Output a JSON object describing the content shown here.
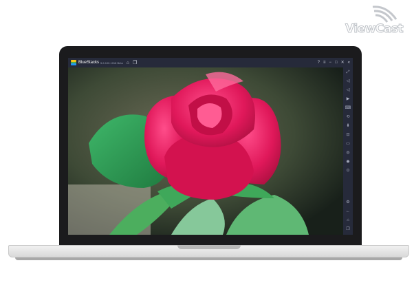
{
  "watermark": {
    "text": "ViewCast",
    "icon": "signal-waves-icon"
  },
  "window": {
    "app_name": "BlueStacks",
    "version": "5.6.100.1018 Beta",
    "title_icons": [
      "home-icon",
      "multi-instance-icon"
    ],
    "controls": [
      "help-icon",
      "menu-icon",
      "minimize-icon",
      "maximize-icon",
      "close-icon",
      "collapse-sidebar-icon"
    ]
  },
  "content": {
    "subject": "red-rose-photo"
  },
  "sidebar": {
    "top_icons": [
      "fullscreen-icon",
      "volume-up-icon",
      "volume-down-icon",
      "media-icon",
      "keyboard-icon",
      "rotate-icon",
      "install-apk-icon",
      "screenshot-icon",
      "folder-icon",
      "macro-icon",
      "eco-mode-icon",
      "settings-sync-icon"
    ],
    "bottom_icons": [
      "settings-icon",
      "back-icon",
      "home-icon",
      "recent-apps-icon"
    ]
  },
  "colors": {
    "titlebar": "#262a3a",
    "bezel": "#1b1b1d",
    "rose": "#e0185a"
  }
}
